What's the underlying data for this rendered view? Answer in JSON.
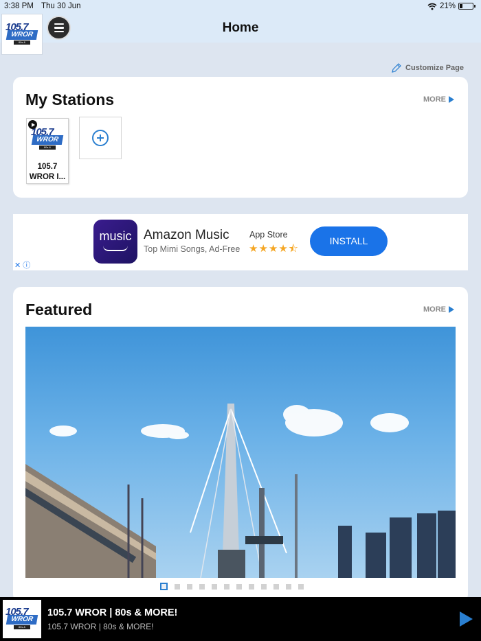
{
  "status_bar": {
    "time": "3:38 PM",
    "date": "Thu 30 Jun",
    "battery": "21%"
  },
  "header": {
    "title": "Home",
    "logo": {
      "number": "105.7",
      "call": "WROR",
      "tag": "80s & MORE!"
    }
  },
  "customize": {
    "label": "Customize Page"
  },
  "my_stations": {
    "title": "My Stations",
    "more_label": "MORE",
    "stations": [
      {
        "line1": "105.7",
        "line2": "WROR I..."
      }
    ]
  },
  "ad": {
    "icon_text": "music",
    "name": "Amazon Music",
    "subtitle": "Top Mimi Songs, Ad-Free",
    "store": "App Store",
    "stars": "★★★★⯪",
    "rating": 4.5,
    "install_label": "INSTALL",
    "close_label": "✕ ⓘ"
  },
  "featured": {
    "title": "Featured",
    "more_label": "MORE",
    "page_count": 12,
    "active_page": 1
  },
  "player": {
    "title": "105.7 WROR | 80s & MORE!",
    "subtitle": "105.7 WROR | 80s & MORE!"
  },
  "colors": {
    "accent": "#2a7fd0",
    "header_bg": "#dceaf8",
    "page_bg": "#dde5f0",
    "install_btn": "#1a73e8"
  }
}
